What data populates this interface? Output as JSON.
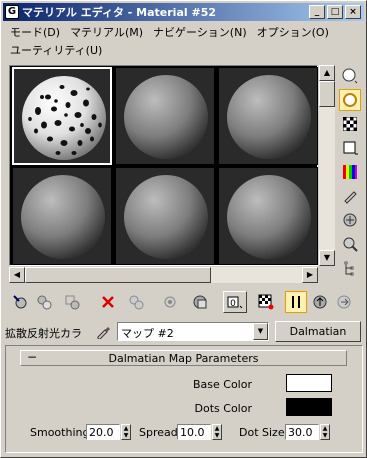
{
  "window": {
    "title": "マテリアル エディタ - Material #52",
    "app_icon_glyph": "G"
  },
  "title_buttons": {
    "minimize": "_",
    "maximize": "□",
    "close": "×"
  },
  "menu": {
    "row1": [
      "モード(D)",
      "マテリアル(M)",
      "ナビゲーション(N)",
      "オプション(O)"
    ],
    "row2": [
      "ユーティリティ(U)"
    ]
  },
  "sample_slots": [
    {
      "material": "dalmatian",
      "active": true
    },
    {
      "material": "default-gray",
      "active": false
    },
    {
      "material": "default-gray",
      "active": false
    },
    {
      "material": "default-gray",
      "active": false
    },
    {
      "material": "default-gray",
      "active": false
    },
    {
      "material": "default-gray",
      "active": false
    }
  ],
  "side_toolbar": [
    "sample-type-icon",
    "backlight-icon",
    "background-checker-icon",
    "sample-uv-tiling-icon",
    "video-color-check-icon",
    "make-preview-icon",
    "options-icon",
    "select-by-material-icon",
    "material-map-navigator-icon"
  ],
  "main_toolbar": [
    "get-material-icon",
    "put-to-scene-icon",
    "assign-to-selection-icon",
    "reset-map-icon",
    "make-copy-icon",
    "make-unique-icon",
    "put-to-library-icon",
    "material-effects-channel-icon",
    "show-map-in-viewport-icon",
    "show-end-result-icon",
    "go-to-parent-icon",
    "go-forward-to-sibling-icon"
  ],
  "map_row": {
    "channel_label": "拡散反射光カラ",
    "map_name": "マップ #2",
    "map_type_button": "Dalmatian"
  },
  "rollout": {
    "title": "Dalmatian Map Parameters",
    "collapse_glyph": "−",
    "base_color_label": "Base Color",
    "base_color": "#ffffff",
    "dots_color_label": "Dots Color",
    "dots_color": "#000000",
    "smoothing_label": "Smoothing",
    "smoothing_value": "20.0",
    "spread_label": "Spread",
    "spread_value": "10.0",
    "dot_size_label": "Dot Size",
    "dot_size_value": "30.0"
  },
  "colors": {
    "titlebar_start": "#0a246a",
    "titlebar_end": "#a6caf0",
    "dialog_face": "#d4d0c8",
    "active_tool_highlight": "#fdf0b0"
  }
}
